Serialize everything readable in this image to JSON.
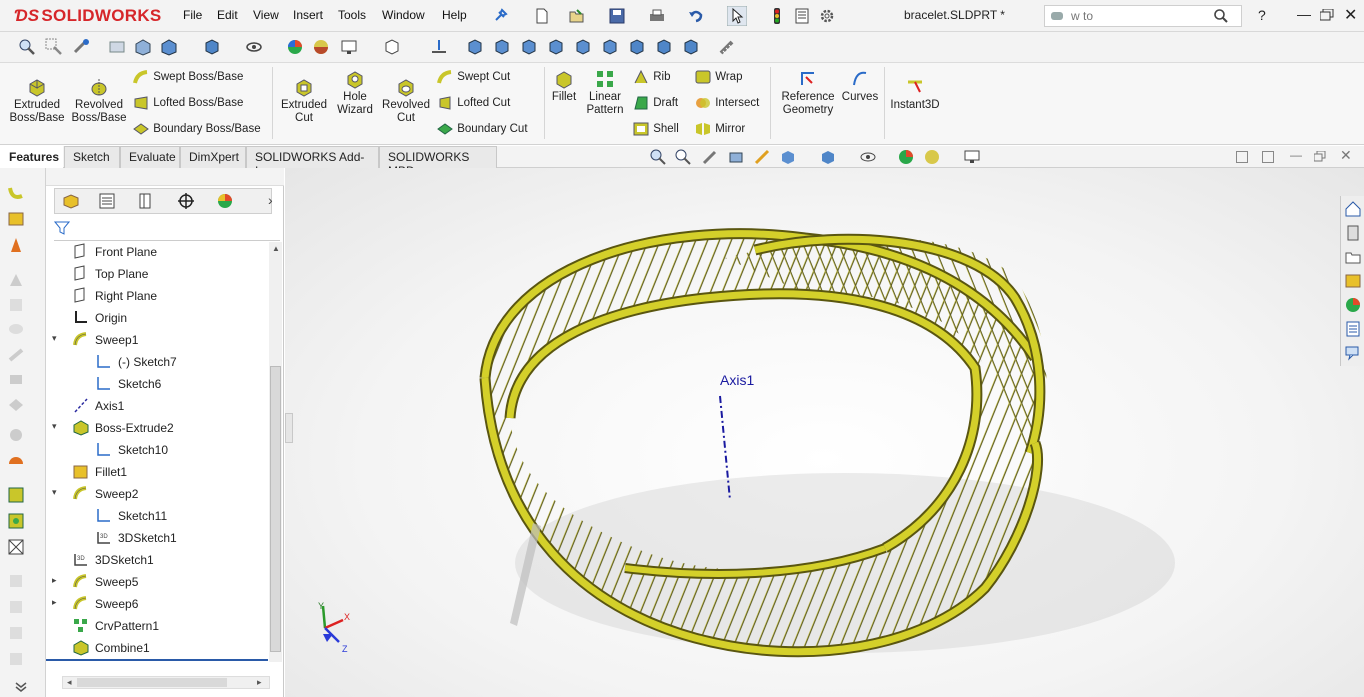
{
  "app": {
    "name": "SOLIDWORKS",
    "file_title": "bracelet.SLDPRT *"
  },
  "menu": [
    "File",
    "Edit",
    "View",
    "Insert",
    "Tools",
    "Window",
    "Help"
  ],
  "search": {
    "value": "w to"
  },
  "ribbon": {
    "extruded_boss": "Extruded Boss/Base",
    "revolved_boss": "Revolved Boss/Base",
    "swept_boss": "Swept Boss/Base",
    "lofted_boss": "Lofted Boss/Base",
    "boundary_boss": "Boundary Boss/Base",
    "extruded_cut": "Extruded Cut",
    "hole_wizard": "Hole Wizard",
    "revolved_cut": "Revolved Cut",
    "swept_cut": "Swept Cut",
    "lofted_cut": "Lofted Cut",
    "boundary_cut": "Boundary Cut",
    "fillet": "Fillet",
    "linear_pattern": "Linear Pattern",
    "rib": "Rib",
    "draft": "Draft",
    "shell": "Shell",
    "wrap": "Wrap",
    "intersect": "Intersect",
    "mirror": "Mirror",
    "reference_geometry": "Reference Geometry",
    "curves": "Curves",
    "instant3d": "Instant3D"
  },
  "tabs": [
    "Features",
    "Sketch",
    "Evaluate",
    "DimXpert",
    "SOLIDWORKS Add-Ins",
    "SOLIDWORKS MBD"
  ],
  "tree": [
    {
      "label": "Front Plane",
      "icon": "plane-icon",
      "indent": 0,
      "expander": ""
    },
    {
      "label": "Top Plane",
      "icon": "plane-icon",
      "indent": 0,
      "expander": ""
    },
    {
      "label": "Right Plane",
      "icon": "plane-icon",
      "indent": 0,
      "expander": ""
    },
    {
      "label": "Origin",
      "icon": "origin-icon",
      "indent": 0,
      "expander": ""
    },
    {
      "label": "Sweep1",
      "icon": "sweep-icon",
      "indent": 0,
      "expander": "expanded"
    },
    {
      "label": "(-) Sketch7",
      "icon": "sketch-icon",
      "indent": 1,
      "expander": ""
    },
    {
      "label": "Sketch6",
      "icon": "sketch-icon",
      "indent": 1,
      "expander": ""
    },
    {
      "label": "Axis1",
      "icon": "axis-icon",
      "indent": 0,
      "expander": ""
    },
    {
      "label": "Boss-Extrude2",
      "icon": "extrude-icon",
      "indent": 0,
      "expander": "expanded"
    },
    {
      "label": "Sketch10",
      "icon": "sketch-icon",
      "indent": 1,
      "expander": ""
    },
    {
      "label": "Fillet1",
      "icon": "fillet-icon",
      "indent": 0,
      "expander": ""
    },
    {
      "label": "Sweep2",
      "icon": "sweep-icon",
      "indent": 0,
      "expander": "expanded"
    },
    {
      "label": "Sketch11",
      "icon": "sketch-icon",
      "indent": 1,
      "expander": ""
    },
    {
      "label": "3DSketch1",
      "icon": "3dsketch-icon",
      "indent": 1,
      "expander": ""
    },
    {
      "label": "3DSketch1",
      "icon": "3dsketch-icon",
      "indent": 0,
      "expander": ""
    },
    {
      "label": "Sweep5",
      "icon": "sweep-icon",
      "indent": 0,
      "expander": "collapsed"
    },
    {
      "label": "Sweep6",
      "icon": "sweep-icon",
      "indent": 0,
      "expander": "collapsed"
    },
    {
      "label": "CrvPattern1",
      "icon": "curve-pattern-icon",
      "indent": 0,
      "expander": ""
    },
    {
      "label": "Combine1",
      "icon": "combine-icon",
      "indent": 0,
      "expander": ""
    }
  ],
  "viewport": {
    "axis_label": "Axis1"
  },
  "triad": {
    "x": "X",
    "y": "Y",
    "z": "Z"
  },
  "colors": {
    "accent": "#d6262a",
    "model": "#c9c62a",
    "axis": "#1a1aa0"
  }
}
